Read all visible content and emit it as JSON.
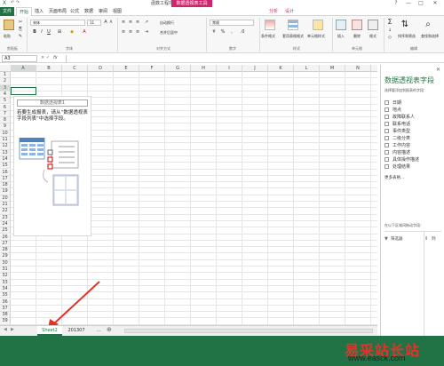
{
  "window": {
    "title": "函数工程项目工作簿副 - Excel",
    "contextual_tab_group": "数据透视表工具",
    "controls": [
      "?",
      "—",
      "□",
      "✕"
    ]
  },
  "tabs": [
    {
      "label": "文件",
      "kind": "file"
    },
    {
      "label": "开始",
      "kind": "active"
    },
    {
      "label": "插入",
      "kind": "normal"
    },
    {
      "label": "页面布局",
      "kind": "normal"
    },
    {
      "label": "公式",
      "kind": "normal"
    },
    {
      "label": "数据",
      "kind": "normal"
    },
    {
      "label": "审阅",
      "kind": "normal"
    },
    {
      "label": "视图",
      "kind": "normal"
    },
    {
      "label": "分析",
      "kind": "pt"
    },
    {
      "label": "设计",
      "kind": "pt"
    }
  ],
  "ribbon": {
    "paste_label": "粘贴",
    "font_name": "宋体",
    "font_size": "11",
    "wrap_label": "自动换行",
    "merge_label": "合并后居中",
    "number_format": "常规",
    "cond_format_label": "条件格式",
    "table_format_label": "套用表格格式",
    "cell_style_label": "单元格样式",
    "insert_label": "插入",
    "delete_label": "删除",
    "format_label": "格式",
    "sort_label": "排序和筛选",
    "find_label": "查找和选择",
    "groups": [
      "剪贴板",
      "字体",
      "对齐方式",
      "数字",
      "样式",
      "单元格",
      "编辑"
    ]
  },
  "formula_bar": {
    "name_box": "A3",
    "fx": "fx",
    "value": ""
  },
  "grid": {
    "columns": [
      "A",
      "B",
      "C",
      "D",
      "E",
      "F",
      "G",
      "H",
      "I",
      "J",
      "K",
      "L",
      "M",
      "N"
    ],
    "selected_column": "A",
    "rows": [
      "1",
      "2",
      "3",
      "4",
      "5",
      "6",
      "7",
      "8",
      "9",
      "10",
      "11",
      "12",
      "13",
      "14",
      "15",
      "16",
      "17",
      "18",
      "19",
      "20",
      "21",
      "22",
      "23",
      "24",
      "25",
      "26",
      "27",
      "28",
      "29",
      "30",
      "31",
      "32",
      "33",
      "34",
      "35",
      "36",
      "37",
      "38",
      "39",
      "40"
    ]
  },
  "pivot_placeholder": {
    "title": "数据透视表1",
    "message": "若要生成报表，请从“数据透视表字段列表”中选择字段。"
  },
  "sheet_tabs": [
    "Sheet2",
    "201307",
    "..."
  ],
  "field_pane": {
    "title": "数据透视表字段",
    "subtitle": "选择要添加到报表的字段：",
    "fields": [
      "日期",
      "地点",
      "故障联系人",
      "联系电话",
      "事件类型",
      "二级分类",
      "工作内容",
      "内容描述",
      "具体操作描述",
      "处理结果"
    ],
    "more": "更多表格...",
    "drag_hint": "在以下区域间拖动字段：",
    "filters_label": "筛选器",
    "columns_label": "列"
  },
  "watermark": {
    "line1": "易采站长站",
    "line2": "www.easck.com"
  },
  "colors": {
    "excel_green": "#217346",
    "pivot_tools_pink": "#d2246e",
    "arrow_red": "#e2332b"
  }
}
